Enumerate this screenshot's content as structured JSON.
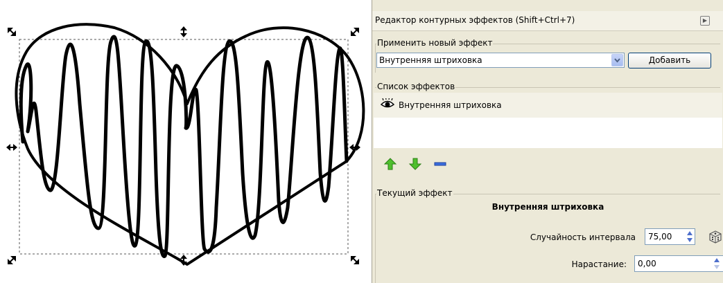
{
  "canvas": {
    "handles": [
      "resize-handle-top-left",
      "resize-handle-top",
      "resize-handle-top-right",
      "resize-handle-left",
      "resize-handle-right",
      "resize-handle-bottom-left",
      "resize-handle-bottom",
      "resize-handle-bottom-right"
    ]
  },
  "panel": {
    "title": "Редактор контурных эффектов (Shift+Ctrl+7)",
    "apply_group": {
      "label": "Применить новый эффект",
      "selected_effect": "Внутренняя штриховка",
      "add_button": "Добавить"
    },
    "effects_list": {
      "label": "Список эффектов",
      "items": [
        {
          "name": "Внутренняя штриховка",
          "icon": "eye-icon",
          "visible": true
        }
      ],
      "toolbar": [
        "move-up-icon",
        "move-down-icon",
        "remove-icon"
      ]
    },
    "current_effect": {
      "label": "Текущий эффект",
      "name": "Внутренняя штриховка",
      "params": [
        {
          "label": "Случайность интервала",
          "value": "75,00"
        },
        {
          "label": "Нарастание:",
          "value": "0,00"
        }
      ]
    },
    "colors": {
      "panel_bg": "#ece9d8",
      "up_arrow": "#3aa52a",
      "down_arrow": "#3aa52a",
      "remove": "#2a5bd7"
    }
  }
}
